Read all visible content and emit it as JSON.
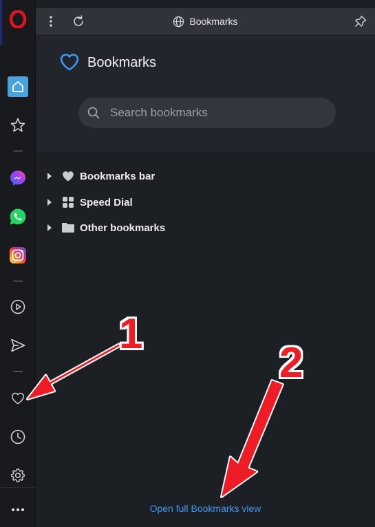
{
  "toolbar": {
    "title": "Bookmarks",
    "menu_icon": "kebab-menu-icon",
    "reload_icon": "reload-icon",
    "globe_icon": "globe-icon",
    "pin_icon": "pin-icon"
  },
  "header": {
    "title": "Bookmarks",
    "icon": "heart-icon"
  },
  "search": {
    "placeholder": "Search bookmarks"
  },
  "tree": [
    {
      "label": "Bookmarks bar",
      "icon": "heart-icon"
    },
    {
      "label": "Speed Dial",
      "icon": "grid-icon"
    },
    {
      "label": "Other bookmarks",
      "icon": "folder-icon"
    }
  ],
  "footer": {
    "open_full": "Open full Bookmarks view"
  },
  "sidebar": {
    "items": [
      "opera-logo-icon",
      "home-icon",
      "star-icon",
      "messenger-icon",
      "whatsapp-icon",
      "instagram-icon",
      "player-icon",
      "send-icon",
      "heart-icon",
      "history-icon",
      "settings-icon",
      "more-icon"
    ]
  },
  "annotations": {
    "first": "1",
    "second": "2"
  },
  "colors": {
    "accent": "#3b9bf5",
    "annotation": "#ee1c25",
    "active_home": "#4aa3df"
  }
}
